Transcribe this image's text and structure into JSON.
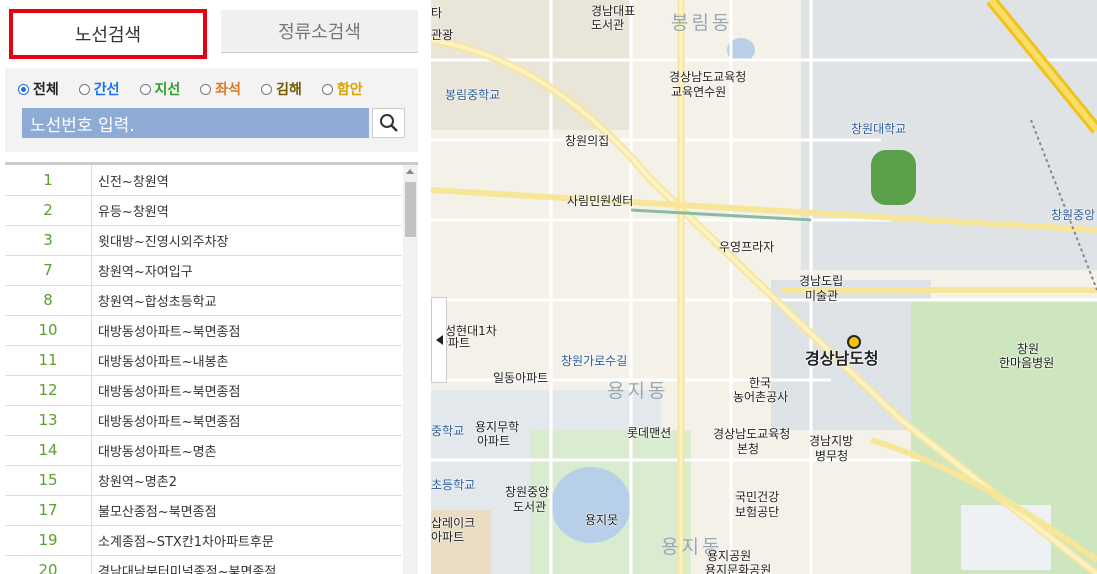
{
  "tabs": {
    "route_search": "노선검색",
    "stop_search": "정류소검색"
  },
  "filters": [
    {
      "label": "전체",
      "color": "#222222",
      "checked": true
    },
    {
      "label": "간선",
      "color": "#1a73e8",
      "checked": false
    },
    {
      "label": "지선",
      "color": "#2aa02a",
      "checked": false
    },
    {
      "label": "좌석",
      "color": "#e0781e",
      "checked": false
    },
    {
      "label": "김해",
      "color": "#7a5a00",
      "checked": false
    },
    {
      "label": "함안",
      "color": "#d8a400",
      "checked": false
    }
  ],
  "search": {
    "placeholder": "노선번호 입력."
  },
  "routes": [
    {
      "num": "1",
      "name": "신전~창원역"
    },
    {
      "num": "2",
      "name": "유등~창원역"
    },
    {
      "num": "3",
      "name": "윗대방~진영시외주차장"
    },
    {
      "num": "7",
      "name": "창원역~자여입구"
    },
    {
      "num": "8",
      "name": "창원역~합성초등학교"
    },
    {
      "num": "10",
      "name": "대방동성아파트~북면종점"
    },
    {
      "num": "11",
      "name": "대방동성아파트~내봉촌"
    },
    {
      "num": "12",
      "name": "대방동성아파트~북면종점"
    },
    {
      "num": "13",
      "name": "대방동성아파트~북면종점"
    },
    {
      "num": "14",
      "name": "대방동성아파트~명촌"
    },
    {
      "num": "15",
      "name": "창원역~명촌2"
    },
    {
      "num": "17",
      "name": "불모산종점~북면종점"
    },
    {
      "num": "19",
      "name": "소계종점~STX칸1차아파트후문"
    },
    {
      "num": "20",
      "name": "경남대남부터미널종점~북면종점"
    }
  ],
  "map": {
    "labels": [
      {
        "text": "경남대표",
        "cls": ""
      },
      {
        "text": "도서관",
        "cls": ""
      },
      {
        "text": "봉림동",
        "cls": "district"
      },
      {
        "text": "경상남도교육청",
        "cls": ""
      },
      {
        "text": "교육연수원",
        "cls": ""
      },
      {
        "text": "봉림중학교",
        "cls": "blue"
      },
      {
        "text": "창원대학교",
        "cls": "blue"
      },
      {
        "text": "창원의집",
        "cls": ""
      },
      {
        "text": "사림민원센터",
        "cls": ""
      },
      {
        "text": "창원중앙",
        "cls": "blue"
      },
      {
        "text": "우영프라자",
        "cls": ""
      },
      {
        "text": "경남도립",
        "cls": ""
      },
      {
        "text": "미술관",
        "cls": ""
      },
      {
        "text": "성현대1차",
        "cls": ""
      },
      {
        "text": "아파트",
        "cls": ""
      },
      {
        "text": "창원가로수길",
        "cls": "blue"
      },
      {
        "text": "경상남도청",
        "cls": "big"
      },
      {
        "text": "창원",
        "cls": ""
      },
      {
        "text": "한마음병원",
        "cls": ""
      },
      {
        "text": "일동아파트",
        "cls": ""
      },
      {
        "text": "용지동",
        "cls": "district"
      },
      {
        "text": "한국",
        "cls": ""
      },
      {
        "text": "농어촌공사",
        "cls": ""
      },
      {
        "text": "중학교",
        "cls": "blue"
      },
      {
        "text": "용지무학",
        "cls": ""
      },
      {
        "text": "아파트",
        "cls": ""
      },
      {
        "text": "롯데맨션",
        "cls": ""
      },
      {
        "text": "경상남도교육청",
        "cls": ""
      },
      {
        "text": "본청",
        "cls": ""
      },
      {
        "text": "경남지방",
        "cls": ""
      },
      {
        "text": "병무청",
        "cls": ""
      },
      {
        "text": "초등학교",
        "cls": "blue"
      },
      {
        "text": "창원중앙",
        "cls": ""
      },
      {
        "text": "도서관",
        "cls": ""
      },
      {
        "text": "국민건강",
        "cls": ""
      },
      {
        "text": "보험공단",
        "cls": ""
      },
      {
        "text": "용지못",
        "cls": ""
      },
      {
        "text": "삽레이크",
        "cls": ""
      },
      {
        "text": "아파트",
        "cls": ""
      },
      {
        "text": "용지동",
        "cls": "district"
      },
      {
        "text": "용지공원",
        "cls": ""
      },
      {
        "text": "용지문화공원",
        "cls": ""
      },
      {
        "text": "관광",
        "cls": ""
      },
      {
        "text": "타",
        "cls": ""
      }
    ]
  }
}
